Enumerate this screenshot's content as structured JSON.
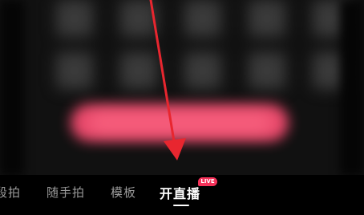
{
  "tabs": [
    {
      "label": "段拍"
    },
    {
      "label": "随手拍"
    },
    {
      "label": "模板"
    },
    {
      "label": "开直播"
    }
  ],
  "active_tab": "开直播",
  "live_badge": "LIVE",
  "colors": {
    "accent": "#f24a6e",
    "arrow": "#e8262f",
    "tabbar_bg": "#000000"
  },
  "icons": [
    "annotation-arrow-icon"
  ]
}
